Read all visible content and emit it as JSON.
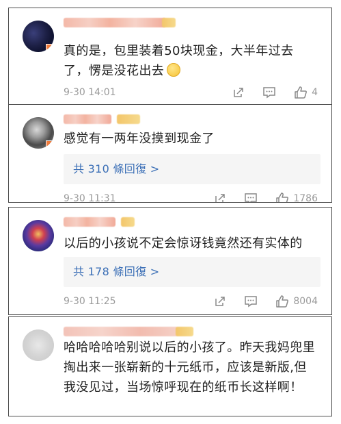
{
  "colors": {
    "text": "#222222",
    "meta": "#9a9a9a",
    "link": "#3b6fb6",
    "reply_bg": "#f5f5f5",
    "border": "#4a4a4a"
  },
  "comments": [
    {
      "text": "真的是，包里装着50块现金，大半年过去了，愣是没花出去",
      "emoji": "thinking-emoji",
      "time": "9-30 14:01",
      "likes": "4",
      "replies": ""
    },
    {
      "text": "感觉有一两年没摸到现金了",
      "replies": "共 310 條回復 >",
      "time": "9-30 11:31",
      "likes": "1786"
    },
    {
      "text": "以后的小孩说不定会惊讶钱竟然还有实体的",
      "replies": "共 178 條回復 >",
      "time": "9-30 11:25",
      "likes": "8004"
    },
    {
      "text": "哈哈哈哈哈别说以后的小孩了。昨天我妈兜里掏出来一张崭新的十元纸币，应该是新版,但我没见过，当场惊呼现在的纸币长这样啊！"
    }
  ],
  "icons": {
    "share": "share-icon",
    "comment": "comment-icon",
    "like": "thumbs-up-icon"
  }
}
